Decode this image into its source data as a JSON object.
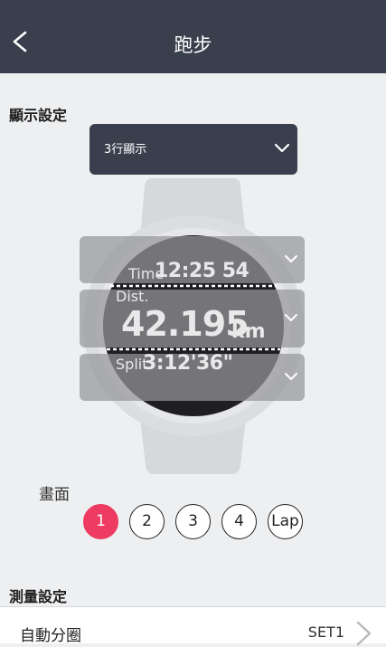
{
  "header": {
    "title": "跑步"
  },
  "display": {
    "section_title": "顯示設定",
    "layout_value": "3行顯示",
    "rows": [
      {
        "label": "Time",
        "value": "12:25 54"
      },
      {
        "label": "Dist.",
        "value": "42.195",
        "unit": "km"
      },
      {
        "label": "Split",
        "value": "3:12'36\""
      }
    ]
  },
  "screens": {
    "label": "畫面",
    "pages": [
      "1",
      "2",
      "3",
      "4",
      "Lap"
    ],
    "selected": "1"
  },
  "measure": {
    "section_title": "測量設定",
    "auto_lap_label": "自動分圈",
    "auto_lap_value": "SET1"
  },
  "colors": {
    "header_bg": "#3a3f4e",
    "accent": "#ee3b62",
    "background": "#eeeff1"
  }
}
